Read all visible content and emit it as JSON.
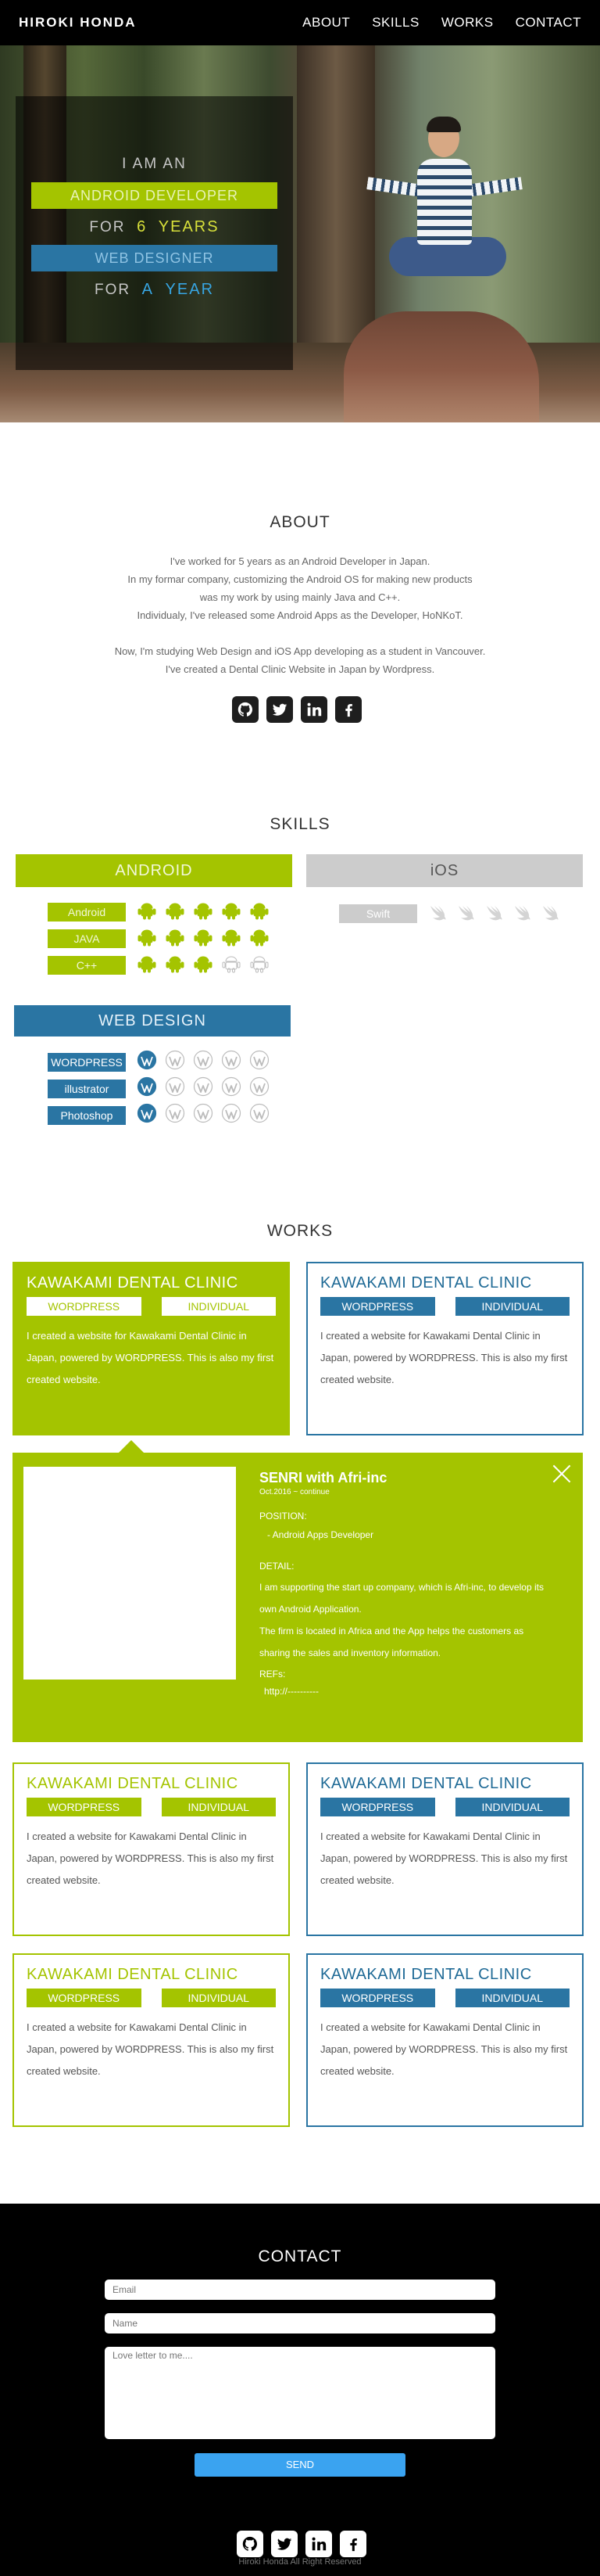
{
  "nav": {
    "logo": "HIROKI HONDA",
    "menu": [
      "ABOUT",
      "SKILLS",
      "WORKS",
      "CONTACT"
    ]
  },
  "hero": {
    "line1": "I AM AN",
    "bar1": "ANDROID DEVELOPER",
    "line2_prefix": "FOR",
    "line2_value": "6",
    "line2_suffix": "YEARS",
    "bar2": "WEB DESIGNER",
    "line3_prefix": "FOR",
    "line3_value": "A",
    "line3_suffix": "YEAR"
  },
  "about": {
    "title": "ABOUT",
    "paragraph1": [
      "I've worked for 5 years as an Android Developer in Japan.",
      "In my formar company, customizing the Android OS for making new products",
      "was my work by using mainly Java and C++.",
      "Individualy, I've released some Android Apps as the Developer, HoNKoT."
    ],
    "paragraph2": [
      "Now, I'm studying Web Design and iOS App developing as a student in Vancouver.",
      "I've created a Dental Clinic Website in Japan by Wordpress."
    ],
    "social_icons": [
      "github-icon",
      "twitter-icon",
      "linkedin-icon",
      "facebook-icon"
    ]
  },
  "skills": {
    "title": "SKILLS",
    "android": {
      "heading": "ANDROID",
      "color": "#a4c400",
      "items": [
        {
          "label": "Android",
          "level": 5,
          "max": 5
        },
        {
          "label": "JAVA",
          "level": 5,
          "max": 5
        },
        {
          "label": "C++",
          "level": 3,
          "max": 5
        }
      ]
    },
    "ios": {
      "heading": "iOS",
      "color": "#cccccc",
      "items": [
        {
          "label": "Swift",
          "level": 0,
          "max": 5
        }
      ]
    },
    "web": {
      "heading": "WEB DESIGN",
      "color": "#2a75a3",
      "items": [
        {
          "label": "WORDPRESS",
          "level": 1,
          "max": 5
        },
        {
          "label": "illustrator",
          "level": 1,
          "max": 5
        },
        {
          "label": "Photoshop",
          "level": 1,
          "max": 5
        }
      ]
    }
  },
  "works": {
    "title": "WORKS",
    "cards": [
      {
        "title": "KAWAKAMI DENTAL CLINIC",
        "tag1": "WORDPRESS",
        "tag2": "INDIVIDUAL",
        "desc": "I created a website for Kawakami Dental Clinic in Japan, powered by WORDPRESS. This is also my first created website."
      },
      {
        "title": "KAWAKAMI DENTAL CLINIC",
        "tag1": "WORDPRESS",
        "tag2": "INDIVIDUAL",
        "desc": "I created a website for Kawakami Dental Clinic in Japan, powered by WORDPRESS. This is also my first created website."
      },
      {
        "title": "KAWAKAMI DENTAL CLINIC",
        "tag1": "WORDPRESS",
        "tag2": "INDIVIDUAL",
        "desc": "I created a website for Kawakami Dental Clinic in Japan, powered by WORDPRESS. This is also my first created website."
      },
      {
        "title": "KAWAKAMI DENTAL CLINIC",
        "tag1": "WORDPRESS",
        "tag2": "INDIVIDUAL",
        "desc": "I created a website for Kawakami Dental Clinic in Japan, powered by WORDPRESS. This is also my first created website."
      },
      {
        "title": "KAWAKAMI DENTAL CLINIC",
        "tag1": "WORDPRESS",
        "tag2": "INDIVIDUAL",
        "desc": "I created a website for Kawakami Dental Clinic in Japan, powered by WORDPRESS. This is also my first created website."
      },
      {
        "title": "KAWAKAMI DENTAL CLINIC",
        "tag1": "WORDPRESS",
        "tag2": "INDIVIDUAL",
        "desc": "I created a website for Kawakami Dental Clinic in Japan, powered by WORDPRESS. This is also my first created website."
      }
    ],
    "detail": {
      "title": "SENRI with Afri-inc",
      "sub": "Oct.2016 ~ continue",
      "position_label": "POSITION:",
      "position_value": "- Android Apps Developer",
      "detail_label": "DETAIL:",
      "detail_text1": "I am supporting the start up company, which is Afri-inc, to develop its own Android Application.",
      "detail_text2": "The firm is located in Africa and the App helps the customers as sharing the sales and inventory information.",
      "refs_label": "REFs:",
      "refs_value": "http://----------"
    }
  },
  "contact": {
    "title": "CONTACT",
    "email_placeholder": "Email",
    "name_placeholder": "Name",
    "message_placeholder": "Love letter to me....",
    "send_label": "SEND",
    "copyright": "Hiroki Honda All Right Reserved"
  },
  "colors": {
    "green": "#a4c400",
    "blue": "#2a75a3",
    "gray": "#cccccc",
    "send": "#3aa3f0"
  }
}
